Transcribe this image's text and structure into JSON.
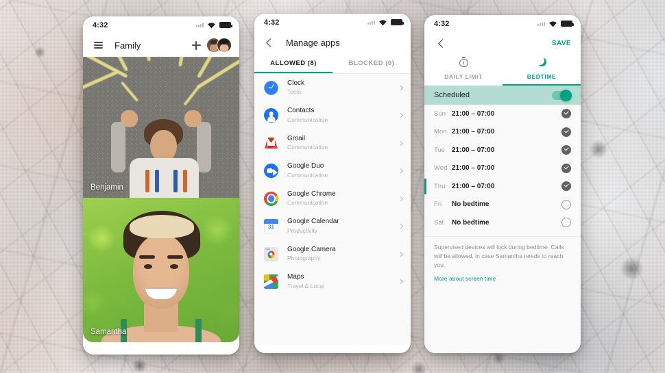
{
  "background": {
    "texture": "marble-stone",
    "tone_left": "#e2d6d0",
    "tone_right": "#e6eaed"
  },
  "theme": {
    "accent": "#00a388",
    "accent_light": "#b3ddd3",
    "text": "#202124",
    "muted": "#9aa0a6"
  },
  "phones": {
    "left": {
      "status": {
        "time": "4:32",
        "wifi_icon": "wifi-icon",
        "battery_icon": "battery-icon",
        "signal_icon": "signal-icon"
      },
      "appbar": {
        "menu_icon": "hamburger-icon",
        "title": "Family",
        "add_icon": "plus-icon",
        "avatar_group_icon": "avatar-group"
      },
      "people": [
        {
          "name": "Benjamin",
          "photo": "child-on-asphalt-with-chalk-sun"
        },
        {
          "name": "Samantha",
          "photo": "girl-smiling-in-grass"
        }
      ]
    },
    "middle": {
      "status": {
        "time": "4:32"
      },
      "appbar": {
        "back_icon": "chevron-left-icon",
        "title": "Manage apps"
      },
      "tabs": [
        {
          "label": "ALLOWED (8)",
          "active": true
        },
        {
          "label": "BLOCKED (0)",
          "active": false
        }
      ],
      "apps": [
        {
          "name": "Clock",
          "category": "Tools",
          "icon": "clock-app-icon"
        },
        {
          "name": "Contacts",
          "category": "Communication",
          "icon": "contacts-app-icon"
        },
        {
          "name": "Gmail",
          "category": "Communication",
          "icon": "gmail-app-icon"
        },
        {
          "name": "Google Duo",
          "category": "Communication",
          "icon": "google-duo-app-icon"
        },
        {
          "name": "Google Chrome",
          "category": "Communication",
          "icon": "chrome-app-icon"
        },
        {
          "name": "Google Calendar",
          "category": "Productivity",
          "icon": "calendar-app-icon",
          "day_number": "31"
        },
        {
          "name": "Google Camera",
          "category": "Photography",
          "icon": "camera-app-icon"
        },
        {
          "name": "Maps",
          "category": "Travel & Local",
          "icon": "maps-app-icon"
        }
      ]
    },
    "right": {
      "status": {
        "time": "4:32"
      },
      "appbar": {
        "back_icon": "chevron-left-icon",
        "save_label": "SAVE"
      },
      "mode_tabs": [
        {
          "label": "DAILY LIMIT",
          "icon": "timer-icon",
          "active": false
        },
        {
          "label": "BEDTIME",
          "icon": "moon-icon",
          "active": true
        }
      ],
      "scheduled": {
        "label": "Scheduled",
        "enabled": true
      },
      "schedule": [
        {
          "day": "Sun",
          "time": "21:00 – 07:00",
          "checked": true,
          "marked": false
        },
        {
          "day": "Mon",
          "time": "21:00 – 07:00",
          "checked": true,
          "marked": false
        },
        {
          "day": "Tue",
          "time": "21:00 – 07:00",
          "checked": true,
          "marked": false
        },
        {
          "day": "Wed",
          "time": "21:00 – 07:00",
          "checked": true,
          "marked": false
        },
        {
          "day": "Thu",
          "time": "21:00 – 07:00",
          "checked": true,
          "marked": true
        },
        {
          "day": "Fri",
          "time": "No bedtime",
          "checked": false,
          "marked": false
        },
        {
          "day": "Sat",
          "time": "No bedtime",
          "checked": false,
          "marked": false
        }
      ],
      "note": "Supervised devices will lock during bedtime. Calls will be allowed, in case Samantha needs to reach you.",
      "note_link": "More about screen time"
    }
  }
}
